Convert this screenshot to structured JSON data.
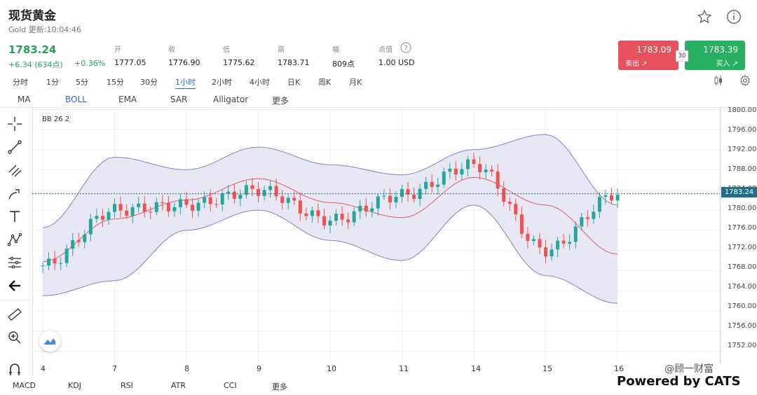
{
  "header": {
    "title": "现货黄金",
    "subtitle": "Gold 更新:10:04:46"
  },
  "quote": {
    "price": "1783.24",
    "change": "+6.34 (634点)",
    "change_pct": "+0.36%",
    "stats": [
      {
        "label": "开",
        "value": "1777.05"
      },
      {
        "label": "收",
        "value": "1776.90"
      },
      {
        "label": "低",
        "value": "1775.62"
      },
      {
        "label": "高",
        "value": "1783.71"
      },
      {
        "label": "幅",
        "value": "809点"
      },
      {
        "label": "点值",
        "value": "1.00 USD"
      }
    ]
  },
  "trade": {
    "sell_price": "1783.09",
    "sell_label": "卖出 ↗",
    "buy_price": "1783.39",
    "buy_label": "买入 ↗",
    "spread": "30",
    "sell_color": "#e5525e",
    "buy_color": "#27b062"
  },
  "timeframes": [
    "分时",
    "1分",
    "5分",
    "15分",
    "30分",
    "1小时",
    "2小时",
    "4小时",
    "日K",
    "周K",
    "月K"
  ],
  "active_timeframe": "1小时",
  "indicators": [
    "MA",
    "BOLL",
    "EMA",
    "SAR",
    "Alligator",
    "更多"
  ],
  "active_indicator": "BOLL",
  "bottom_indicators": [
    "MACD",
    "KDJ",
    "RSI",
    "ATR",
    "CCI",
    "更多"
  ],
  "chart": {
    "legend": "BB  26 2",
    "current_price_label": "1783.24",
    "y_ticks": [
      "1800.00",
      "1796.00",
      "1792.00",
      "1788.00",
      "1784.00",
      "1780.00",
      "1776.00",
      "1772.00",
      "1768.00",
      "1764.00",
      "1760.00",
      "1756.00",
      "1752.00"
    ],
    "x_ticks": [
      "4",
      "7",
      "8",
      "9",
      "10",
      "11",
      "14",
      "15",
      "16"
    ],
    "colors": {
      "up": "#26a69a",
      "down": "#ef5350",
      "band": "#7e84c8",
      "band_fill": "#e6e7f3",
      "mid": "#e0606a"
    }
  },
  "chart_data": {
    "type": "candlestick",
    "indicator": "Bollinger Bands (26, 2)",
    "ylim": [
      1750,
      1800
    ],
    "x_ticks": [
      "4",
      "7",
      "8",
      "9",
      "10",
      "11",
      "14",
      "15",
      "16"
    ],
    "last_price": 1783.24,
    "anchors": [
      {
        "day": "4",
        "close": 1769,
        "upper": 1776.5,
        "lower": 1763
      },
      {
        "day": "7",
        "close": 1780,
        "upper": 1790.5,
        "lower": 1766
      },
      {
        "day": "8",
        "close": 1781,
        "upper": 1788,
        "lower": 1776
      },
      {
        "day": "9",
        "close": 1784,
        "upper": 1792.5,
        "lower": 1780
      },
      {
        "day": "10",
        "close": 1778,
        "upper": 1789,
        "lower": 1774
      },
      {
        "day": "11",
        "close": 1783,
        "upper": 1787,
        "lower": 1770
      },
      {
        "day": "14",
        "close": 1789,
        "upper": 1792,
        "lower": 1781
      },
      {
        "day": "15",
        "close": 1772,
        "upper": 1795,
        "lower": 1767
      },
      {
        "day": "16",
        "close": 1783.24,
        "upper": 1781,
        "lower": 1761.5
      }
    ]
  },
  "watermark": "@顾一财富",
  "powered": "Powered by CATS"
}
